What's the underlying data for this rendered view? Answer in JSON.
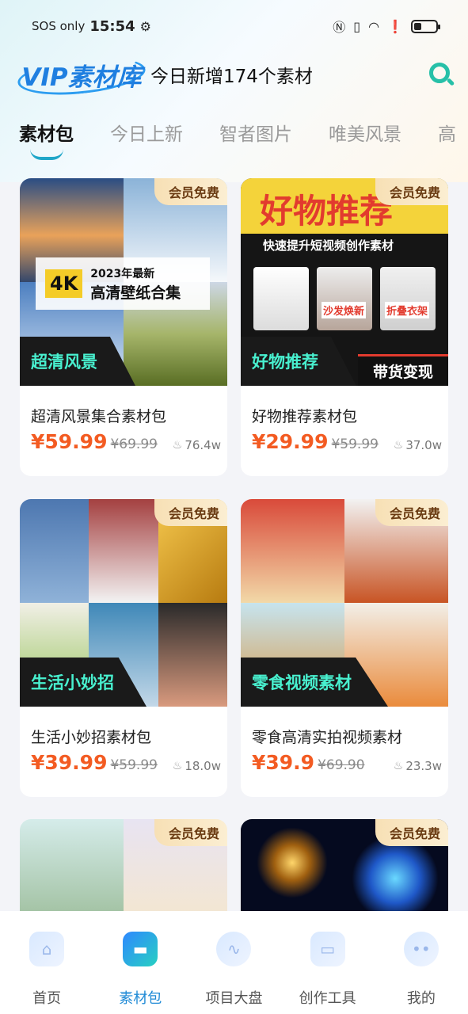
{
  "status_bar": {
    "carrier": "SOS only",
    "time": "15:54"
  },
  "header": {
    "logo": "VIP素材库",
    "subtitle": "今日新增174个素材"
  },
  "tabs": [
    {
      "label": "素材包",
      "active": true
    },
    {
      "label": "今日上新",
      "active": false
    },
    {
      "label": "智者图片",
      "active": false
    },
    {
      "label": "唯美风景",
      "active": false
    },
    {
      "label": "高",
      "active": false
    }
  ],
  "cards": [
    {
      "badge": "会员免费",
      "tag": "超清风景",
      "overlay": {
        "k4": "4K",
        "line1": "2023年最新",
        "line2": "高清壁纸合集"
      },
      "title": "超清风景集合素材包",
      "price": "¥59.99",
      "old_price": "¥69.99",
      "views": "76.4w"
    },
    {
      "badge": "会员免费",
      "tag": "好物推荐",
      "overlay": {
        "big": "好物推荐",
        "sub": "快速提升短视频创作素材",
        "corner": "带货变现",
        "p1": "沙发焕新",
        "p2": "折叠衣架"
      },
      "title": "好物推荐素材包",
      "price": "¥29.99",
      "old_price": "¥59.99",
      "views": "37.0w"
    },
    {
      "badge": "会员免费",
      "tag": "生活小妙招",
      "title": "生活小妙招素材包",
      "price": "¥39.99",
      "old_price": "¥59.99",
      "views": "18.0w"
    },
    {
      "badge": "会员免费",
      "tag": "零食视频素材",
      "title": "零食高清实拍视频素材",
      "price": "¥39.9",
      "old_price": "¥69.90",
      "views": "23.3w"
    },
    {
      "badge": "会员免费"
    },
    {
      "badge": "会员免费"
    }
  ],
  "nav": [
    {
      "label": "首页",
      "icon": "home-icon",
      "active": false
    },
    {
      "label": "素材包",
      "icon": "folder-icon",
      "active": true
    },
    {
      "label": "项目大盘",
      "icon": "chart-icon",
      "active": false
    },
    {
      "label": "创作工具",
      "icon": "toolbox-icon",
      "active": false
    },
    {
      "label": "我的",
      "icon": "profile-icon",
      "active": false
    }
  ],
  "colors": {
    "accent": "#1f8ad6",
    "price": "#f35b22",
    "tag_text": "#48f0cf",
    "search": "#27c0a8"
  }
}
